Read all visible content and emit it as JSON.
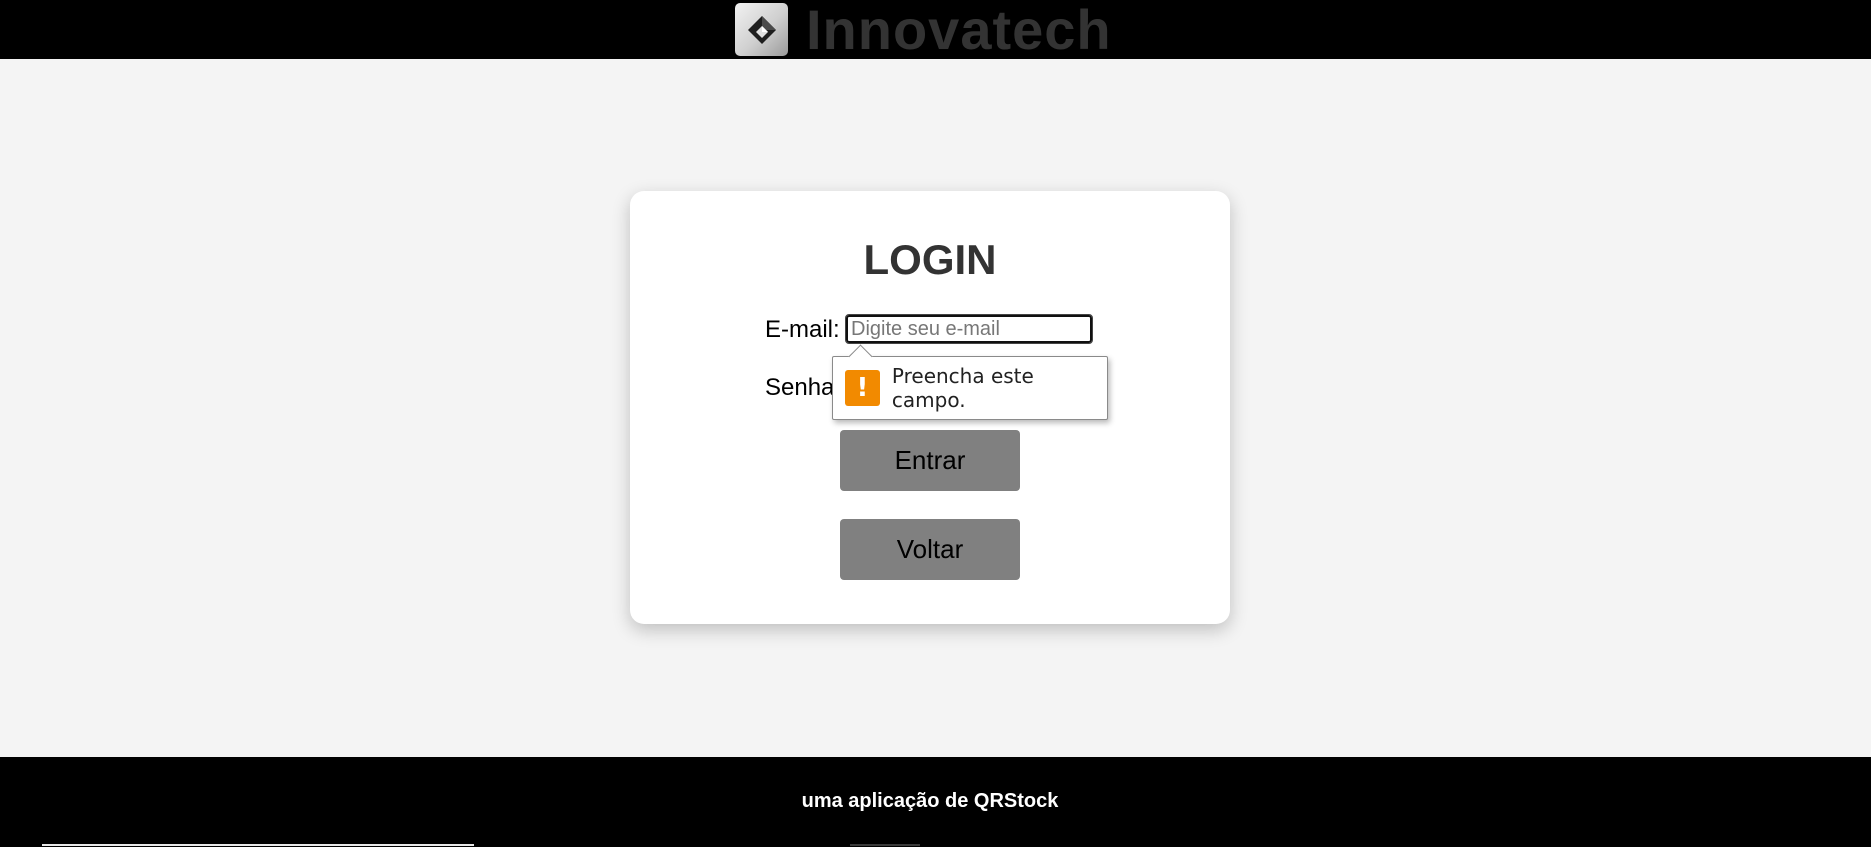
{
  "header": {
    "brand_name": "Innovatech",
    "logo_icon": "diamond-logo-icon",
    "background_color": "#000000"
  },
  "login": {
    "title": "LOGIN",
    "email_label": "E-mail:",
    "email_placeholder": "Digite seu e-mail",
    "email_value": "",
    "password_label": "Senha",
    "enter_button": "Entrar",
    "back_button": "Voltar"
  },
  "validation_tooltip": {
    "icon": "warning-icon",
    "icon_symbol": "!",
    "icon_color": "#f28a00",
    "message": "Preencha este campo."
  },
  "footer": {
    "text": "uma aplicação de QRStock"
  },
  "colors": {
    "page_background": "#f4f4f4",
    "card_background": "#ffffff",
    "button_background": "#808080"
  }
}
